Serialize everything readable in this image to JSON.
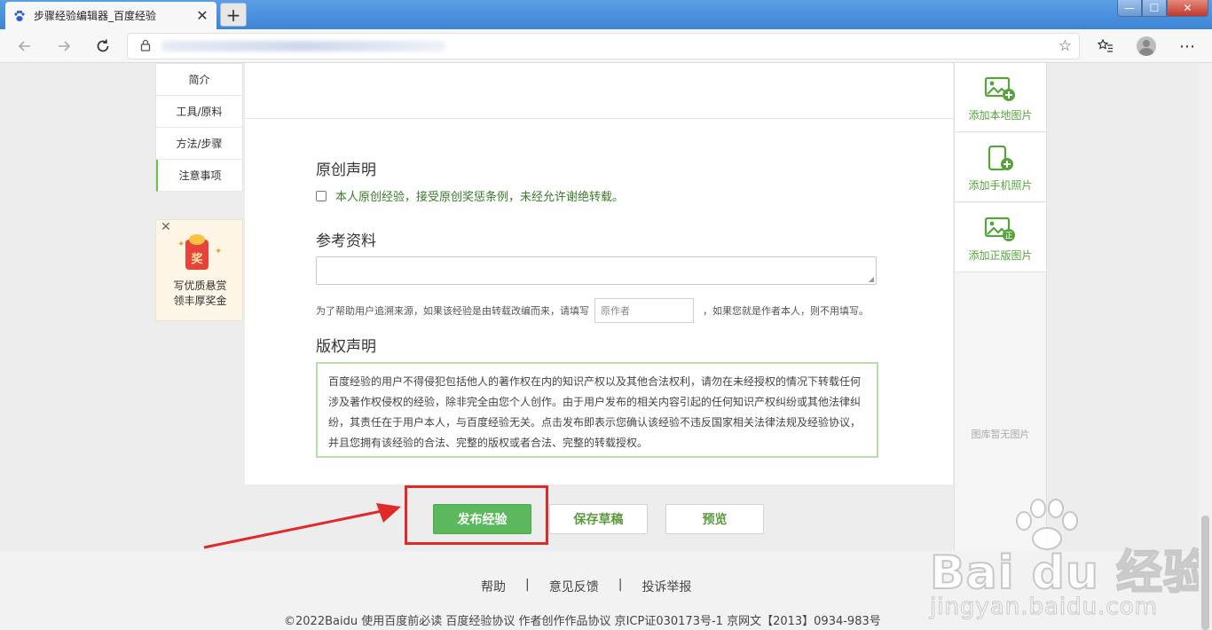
{
  "browser": {
    "tab_title": "步骤经验编辑器_百度经验",
    "tab_close": "✕",
    "new_tab": "+",
    "window_controls": {
      "minimize": "—",
      "maximize": "☐",
      "close": "✕"
    }
  },
  "sidebar": {
    "items": [
      {
        "label": "简介"
      },
      {
        "label": "工具/原料"
      },
      {
        "label": "方法/步骤"
      },
      {
        "label": "注意事项"
      }
    ]
  },
  "promo": {
    "close": "✕",
    "badge": "奖",
    "line1": "写优质悬赏",
    "line2": "领丰厚奖金"
  },
  "original": {
    "title": "原创声明",
    "checkbox_label": "本人原创经验，接受原创奖惩条例，未经允许谢绝转载。"
  },
  "reference": {
    "title": "参考资料",
    "source_prefix": "为了帮助用户追溯来源，如果该经验是由转载改编而来，请填写",
    "author_placeholder": "原作者",
    "source_suffix": "，如果您就是作者本人，则不用填写。"
  },
  "copyright": {
    "title": "版权声明",
    "text": "百度经验的用户不得侵犯包括他人的著作权在内的知识产权以及其他合法权利，请勿在未经授权的情况下转载任何涉及著作权侵权的经验，除非完全由您个人创作。由于用户发布的相关内容引起的任何知识产权纠纷或其他法律纠纷，其责任在于用户本人，与百度经验无关。点击发布即表示您确认该经验不违反国家相关法律法规及经验协议，并且您拥有该经验的合法、完整的版权或者合法、完整的转载授权。"
  },
  "actions": {
    "publish": "发布经验",
    "save_draft": "保存草稿",
    "preview": "预览"
  },
  "right_panel": {
    "add_local": "添加本地图片",
    "add_phone": "添加手机照片",
    "add_licensed": "添加正版图片",
    "licensed_badge": "正",
    "empty_library": "图库暂无图片"
  },
  "footer": {
    "links": [
      {
        "label": "帮助"
      },
      {
        "label": "意见反馈"
      },
      {
        "label": "投诉举报"
      }
    ],
    "separator": "|",
    "copyright": "©2022Baidu  使用百度前必读  百度经验协议  作者创作作品协议   京ICP证030173号-1 京网文【2013】0934-983号"
  },
  "watermark": {
    "brand": "Bai du 经验",
    "domain": "jingyan.baidu.com"
  },
  "colors": {
    "accent_green": "#5cb85c",
    "highlight_red": "#e02a2a",
    "link_green": "#56a33d"
  }
}
